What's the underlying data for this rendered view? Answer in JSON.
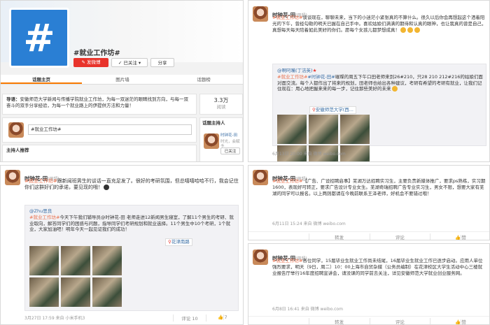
{
  "profile": {
    "logo_glyph": "#",
    "title": "#就业工作坊#",
    "post_button": "发微博",
    "follow_button": "已关注",
    "share_button": "分享",
    "tabs": [
      "话题主页",
      "图片墙",
      "话题榜"
    ],
    "intro_label": "导语：",
    "intro_text": "安徽师范大学新闻与传播学院就业工作坊，为每一双迷茫的眼睛找到方向，与每一双奋斗的双手分享经验，为每一个就业路上的伊提供方法和力量！",
    "count_value": "3.3万",
    "count_label": "阅读",
    "input_value": "#就业工作坊#",
    "host_label": "话题主持人",
    "recommend_label": "主持人推荐",
    "host_name": "时钟花-田",
    "host_sub": "时光，会赋予",
    "host_follow": "已关注"
  },
  "post_top_right": {
    "user": "时钟花-田",
    "user_tag": "(田超)",
    "hashtag": "#就业工作坊#",
    "text": "谈谈现在，聊聊未来，当下的小迷茫小紧张真的不算什么。很久以后你会再想起这个洒着阳光的下午，曾经勾勒的明天已握在自己手中。喜欢姑娘们满满的期待和认真的眼神，也让我真的曾是自己，真想每天每天陪着如此美好的你们。愿每个女孩儿都梦想成真！",
    "repost_user": "@啊叼嘴(丁洁英)",
    "repost_hashtag": "#就业工作坊#",
    "repost_mention": "#时钟花-田#",
    "repost_text": "璀璨的周五下午口田老师来到26#210，只28 210 212#216的姑娘们面对面交流。每个人都作出了将来的规划，田老师也给出各种建议，考研有希望的考研有就业，让我们记住现在：用心地把握来来的每一步，记住那些美好的未来",
    "repost_location": "安徽师范大学(西...",
    "meta": "6月13日 20:00 来自 微博 weibo.com",
    "actions": [
      "",
      "转发",
      "评论",
      "赞"
    ]
  },
  "post_bottom_left": {
    "user": "时钟花-田",
    "user_tag": "(田超)",
    "hashtag": "#就业工作坊#",
    "text": "跟新闻班男生的谈话一直充足发了。很好的考研氛围，但总嘻嘻哈哈不行，我会记住你们这群好们的承诺，要见现的哦！",
    "repost_user": "@Zhu思良",
    "repost_hashtag": "#就业工作坊#",
    "repost_text": "今天下午我们辅导员@时钟花-田 老师走进12新闻男生寝室，了解11个男生的考研、就业取向，解答同学们的困惑与问题，指导同学们考研规划和就业选择。11个男生中10个考研，1个就业，大家加油吧！明年今天一起见证我们的成功！",
    "repost_location": "花津南路",
    "meta": "3月27日 17:59 来自 小米手机3",
    "actions": [
      "",
      "",
      "评论 10",
      "7"
    ]
  },
  "post_mid_right": {
    "user": "时钟花-田",
    "user_tag": "(田超)",
    "hashtag": "#就业工作坊#",
    "text": "【广告、广设招聘启事】芜湖万达招聘实习生，主要负责新媒体推广，要求ps熟练，实习期1600，表现好可转正，要求广告设计专业女生。芜湖奇瑞招聘广告专业实习生，男女不限，想要大家有芜湖的同学可以报名。以上两则都请在今晚前联系王泽老师，好机会不要错过哦！",
    "meta": "6月11日 15:24 来自 微博 weibo.com",
    "actions": [
      "",
      "转发",
      "评论",
      "赞"
    ]
  },
  "post_bottom_right": {
    "user": "时钟花-田",
    "user_tag": "(田超)",
    "hashtag": "#就业工作坊#",
    "text": "各位同学，15届毕业生就业工作尚未结尾，16届毕业生就业工作已逐步启动。应用人单位强烈要求，明天（9日，周二）10：00上海市自贸杂媒（公务员编制）在花津校区大学生活动中心三楼就业报告厅举行16年度招聘宣讲会，请没课的同学前去关注，详见安徽师范大学就业创业服务网。",
    "meta": "6月8日 16:41 来自 微博 weibo.com",
    "actions": [
      "",
      "转发",
      "评论",
      "赞"
    ]
  }
}
